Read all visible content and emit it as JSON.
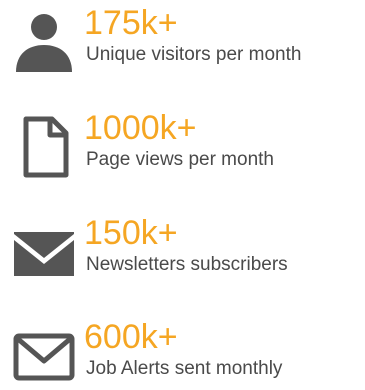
{
  "colors": {
    "accent": "#f5a623",
    "text": "#4a4a4a",
    "icon": "#555555"
  },
  "stats": [
    {
      "icon": "person-icon",
      "value": "175k+",
      "label": "Unique visitors per month"
    },
    {
      "icon": "document-icon",
      "value": "1000k+",
      "label": "Page views per month"
    },
    {
      "icon": "envelope-filled-icon",
      "value": "150k+",
      "label": "Newsletters subscribers"
    },
    {
      "icon": "envelope-outline-icon",
      "value": "600k+",
      "label": "Job Alerts sent monthly"
    }
  ]
}
